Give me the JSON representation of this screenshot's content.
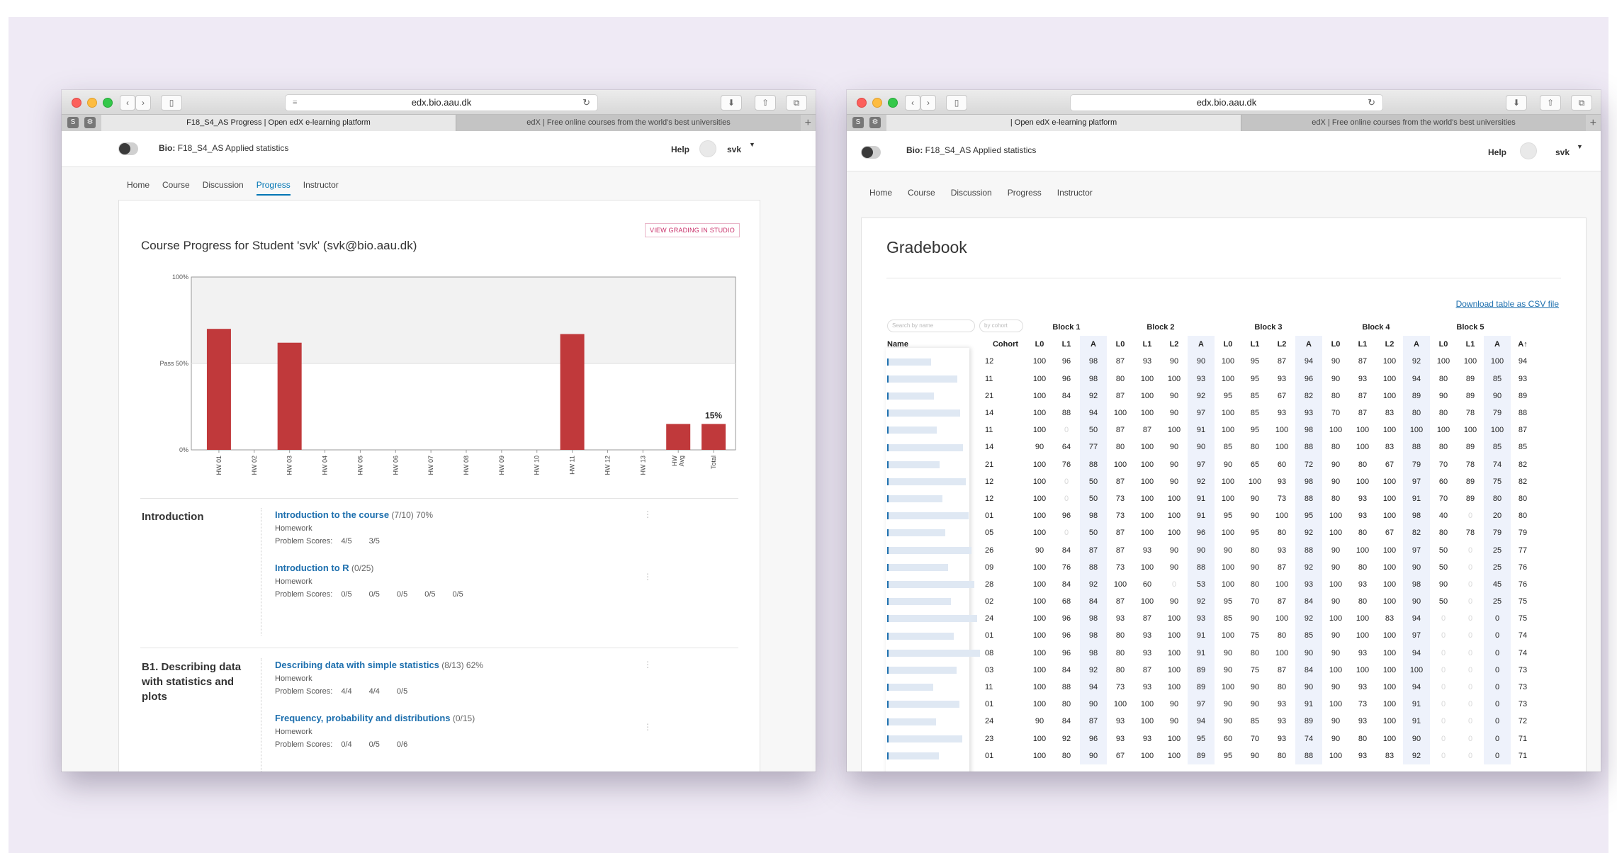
{
  "window1": {
    "url": "edx.bio.aau.dk",
    "tabs": [
      "F18_S4_AS Progress | Open edX e-learning platform",
      "edX | Free online courses from the world's best universities"
    ],
    "course_title_prefix": "Bio:",
    "course_title": "F18_S4_AS Applied statistics",
    "help": "Help",
    "username": "svk",
    "nav": [
      "Home",
      "Course",
      "Discussion",
      "Progress",
      "Instructor"
    ],
    "studio_button": "VIEW GRADING IN STUDIO",
    "progress_title": "Course Progress for Student 'svk' (svk@bio.aau.dk)",
    "sections": [
      {
        "title": "Introduction",
        "subsections": [
          {
            "name": "Introduction to the course",
            "meta": "(7/10) 70%",
            "type": "Homework",
            "scores_label": "Problem Scores:",
            "scores": [
              "4/5",
              "3/5"
            ]
          },
          {
            "name": "Introduction to R",
            "meta": "(0/25)",
            "type": "Homework",
            "scores_label": "Problem Scores:",
            "scores": [
              "0/5",
              "0/5",
              "0/5",
              "0/5",
              "0/5"
            ]
          }
        ]
      },
      {
        "title": "B1. Describing data with statistics and plots",
        "subsections": [
          {
            "name": "Describing data with simple statistics",
            "meta": "(8/13) 62%",
            "type": "Homework",
            "scores_label": "Problem Scores:",
            "scores": [
              "4/4",
              "4/4",
              "0/5"
            ]
          },
          {
            "name": "Frequency, probability and distributions",
            "meta": "(0/15)",
            "type": "Homework",
            "scores_label": "Problem Scores:",
            "scores": [
              "0/4",
              "0/5",
              "0/6"
            ]
          }
        ]
      }
    ]
  },
  "chart_data": {
    "type": "bar",
    "categories": [
      "HW 01",
      "HW 02",
      "HW 03",
      "HW 04",
      "HW 05",
      "HW 06",
      "HW 07",
      "HW 08",
      "HW 09",
      "HW 10",
      "HW 11",
      "HW 12",
      "HW 13",
      "HW Avg",
      "Total"
    ],
    "values": [
      70,
      0,
      62,
      0,
      0,
      0,
      0,
      0,
      0,
      0,
      67,
      0,
      0,
      15,
      15
    ],
    "ylim": [
      0,
      100
    ],
    "y_ticks": [
      "0%",
      "Pass 50%",
      "100%"
    ],
    "annotation": "15%",
    "bar_color": "#c0393b",
    "pass_band_color": "#f2f2f2"
  },
  "window2": {
    "url": "edx.bio.aau.dk",
    "tabs": [
      "| Open edX e-learning platform",
      "edX | Free online courses from the world's best universities"
    ],
    "course_title_prefix": "Bio:",
    "course_title": "F18_S4_AS Applied statistics",
    "help": "Help",
    "username": "svk",
    "nav": [
      "Home",
      "Course",
      "Discussion",
      "Progress",
      "Instructor"
    ],
    "gradebook_title": "Gradebook",
    "download_link": "Download table as CSV file",
    "search_name_placeholder": "Search by name",
    "search_cohort_placeholder": "by cohort",
    "blocks": [
      "Block 1",
      "Block 2",
      "Block 3",
      "Block 4",
      "Block 5"
    ],
    "columns": [
      "Name",
      "Cohort",
      "L0",
      "L1",
      "A",
      "L0",
      "L1",
      "L2",
      "A",
      "L0",
      "L1",
      "L2",
      "A",
      "L0",
      "L1",
      "L2",
      "A",
      "L0",
      "L1",
      "A",
      "A↑"
    ],
    "rows": [
      {
        "cohort": "12",
        "v": [
          "100",
          "96",
          "98",
          "87",
          "93",
          "90",
          "90",
          "100",
          "95",
          "87",
          "94",
          "90",
          "87",
          "100",
          "92",
          "100",
          "100",
          "100",
          "94"
        ]
      },
      {
        "cohort": "11",
        "v": [
          "100",
          "96",
          "98",
          "80",
          "100",
          "100",
          "93",
          "100",
          "95",
          "93",
          "96",
          "90",
          "93",
          "100",
          "94",
          "80",
          "89",
          "85",
          "93"
        ]
      },
      {
        "cohort": "21",
        "v": [
          "100",
          "84",
          "92",
          "87",
          "100",
          "90",
          "92",
          "95",
          "85",
          "67",
          "82",
          "80",
          "87",
          "100",
          "89",
          "90",
          "89",
          "90",
          "89"
        ]
      },
      {
        "cohort": "14",
        "v": [
          "100",
          "88",
          "94",
          "100",
          "100",
          "90",
          "97",
          "100",
          "85",
          "93",
          "93",
          "70",
          "87",
          "83",
          "80",
          "80",
          "78",
          "79",
          "88"
        ]
      },
      {
        "cohort": "11",
        "v": [
          "100",
          "0",
          "50",
          "87",
          "87",
          "100",
          "91",
          "100",
          "95",
          "100",
          "98",
          "100",
          "100",
          "100",
          "100",
          "100",
          "100",
          "100",
          "87"
        ]
      },
      {
        "cohort": "14",
        "v": [
          "90",
          "64",
          "77",
          "80",
          "100",
          "90",
          "90",
          "85",
          "80",
          "100",
          "88",
          "80",
          "100",
          "83",
          "88",
          "80",
          "89",
          "85",
          "85"
        ]
      },
      {
        "cohort": "21",
        "v": [
          "100",
          "76",
          "88",
          "100",
          "100",
          "90",
          "97",
          "90",
          "65",
          "60",
          "72",
          "90",
          "80",
          "67",
          "79",
          "70",
          "78",
          "74",
          "82"
        ]
      },
      {
        "cohort": "12",
        "v": [
          "100",
          "0",
          "50",
          "87",
          "100",
          "90",
          "92",
          "100",
          "100",
          "93",
          "98",
          "90",
          "100",
          "100",
          "97",
          "60",
          "89",
          "75",
          "82"
        ]
      },
      {
        "cohort": "12",
        "v": [
          "100",
          "0",
          "50",
          "73",
          "100",
          "100",
          "91",
          "100",
          "90",
          "73",
          "88",
          "80",
          "93",
          "100",
          "91",
          "70",
          "89",
          "80",
          "80"
        ]
      },
      {
        "cohort": "01",
        "v": [
          "100",
          "96",
          "98",
          "73",
          "100",
          "100",
          "91",
          "95",
          "90",
          "100",
          "95",
          "100",
          "93",
          "100",
          "98",
          "40",
          "0",
          "20",
          "80"
        ]
      },
      {
        "cohort": "05",
        "v": [
          "100",
          "0",
          "50",
          "87",
          "100",
          "100",
          "96",
          "100",
          "95",
          "80",
          "92",
          "100",
          "80",
          "67",
          "82",
          "80",
          "78",
          "79",
          "79"
        ]
      },
      {
        "cohort": "26",
        "v": [
          "90",
          "84",
          "87",
          "87",
          "93",
          "90",
          "90",
          "90",
          "80",
          "93",
          "88",
          "90",
          "100",
          "100",
          "97",
          "50",
          "0",
          "25",
          "77"
        ]
      },
      {
        "cohort": "09",
        "v": [
          "100",
          "76",
          "88",
          "73",
          "100",
          "90",
          "88",
          "100",
          "90",
          "87",
          "92",
          "90",
          "80",
          "100",
          "90",
          "50",
          "0",
          "25",
          "76"
        ]
      },
      {
        "cohort": "28",
        "v": [
          "100",
          "84",
          "92",
          "100",
          "60",
          "0",
          "53",
          "100",
          "80",
          "100",
          "93",
          "100",
          "93",
          "100",
          "98",
          "90",
          "0",
          "45",
          "76"
        ]
      },
      {
        "cohort": "02",
        "v": [
          "100",
          "68",
          "84",
          "87",
          "100",
          "90",
          "92",
          "95",
          "70",
          "87",
          "84",
          "90",
          "80",
          "100",
          "90",
          "50",
          "0",
          "25",
          "75"
        ]
      },
      {
        "cohort": "24",
        "v": [
          "100",
          "96",
          "98",
          "93",
          "87",
          "100",
          "93",
          "85",
          "90",
          "100",
          "92",
          "100",
          "100",
          "83",
          "94",
          "0",
          "0",
          "0",
          "75"
        ]
      },
      {
        "cohort": "01",
        "v": [
          "100",
          "96",
          "98",
          "80",
          "93",
          "100",
          "91",
          "100",
          "75",
          "80",
          "85",
          "90",
          "100",
          "100",
          "97",
          "0",
          "0",
          "0",
          "74"
        ]
      },
      {
        "cohort": "08",
        "v": [
          "100",
          "96",
          "98",
          "80",
          "93",
          "100",
          "91",
          "90",
          "80",
          "100",
          "90",
          "90",
          "93",
          "100",
          "94",
          "0",
          "0",
          "0",
          "74"
        ]
      },
      {
        "cohort": "03",
        "v": [
          "100",
          "84",
          "92",
          "80",
          "87",
          "100",
          "89",
          "90",
          "75",
          "87",
          "84",
          "100",
          "100",
          "100",
          "100",
          "0",
          "0",
          "0",
          "73"
        ]
      },
      {
        "cohort": "11",
        "v": [
          "100",
          "88",
          "94",
          "73",
          "93",
          "100",
          "89",
          "100",
          "90",
          "80",
          "90",
          "90",
          "93",
          "100",
          "94",
          "0",
          "0",
          "0",
          "73"
        ]
      },
      {
        "cohort": "01",
        "v": [
          "100",
          "80",
          "90",
          "100",
          "100",
          "90",
          "97",
          "90",
          "90",
          "93",
          "91",
          "100",
          "73",
          "100",
          "91",
          "0",
          "0",
          "0",
          "73"
        ]
      },
      {
        "cohort": "24",
        "v": [
          "90",
          "84",
          "87",
          "93",
          "100",
          "90",
          "94",
          "90",
          "85",
          "93",
          "89",
          "90",
          "93",
          "100",
          "91",
          "0",
          "0",
          "0",
          "72"
        ]
      },
      {
        "cohort": "23",
        "v": [
          "100",
          "92",
          "96",
          "93",
          "93",
          "100",
          "95",
          "60",
          "70",
          "93",
          "74",
          "90",
          "80",
          "100",
          "90",
          "0",
          "0",
          "0",
          "71"
        ]
      },
      {
        "cohort": "01",
        "v": [
          "100",
          "80",
          "90",
          "67",
          "100",
          "100",
          "89",
          "95",
          "90",
          "80",
          "88",
          "100",
          "93",
          "83",
          "92",
          "0",
          "0",
          "0",
          "71"
        ]
      }
    ]
  }
}
